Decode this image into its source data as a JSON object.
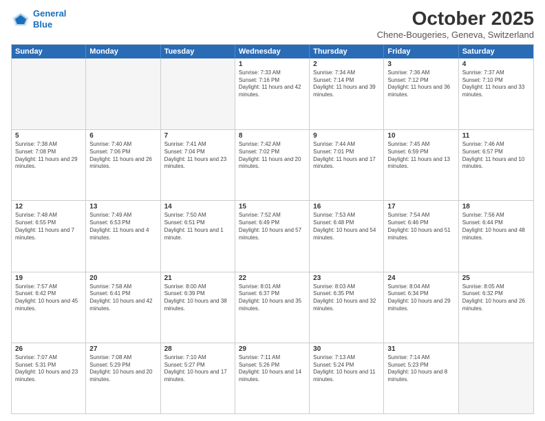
{
  "header": {
    "logo_line1": "General",
    "logo_line2": "Blue",
    "month": "October 2025",
    "location": "Chene-Bougeries, Geneva, Switzerland"
  },
  "days_of_week": [
    "Sunday",
    "Monday",
    "Tuesday",
    "Wednesday",
    "Thursday",
    "Friday",
    "Saturday"
  ],
  "weeks": [
    [
      {
        "day": "",
        "sunrise": "",
        "sunset": "",
        "daylight": "",
        "empty": true
      },
      {
        "day": "",
        "sunrise": "",
        "sunset": "",
        "daylight": "",
        "empty": true
      },
      {
        "day": "",
        "sunrise": "",
        "sunset": "",
        "daylight": "",
        "empty": true
      },
      {
        "day": "1",
        "sunrise": "Sunrise: 7:33 AM",
        "sunset": "Sunset: 7:16 PM",
        "daylight": "Daylight: 11 hours and 42 minutes."
      },
      {
        "day": "2",
        "sunrise": "Sunrise: 7:34 AM",
        "sunset": "Sunset: 7:14 PM",
        "daylight": "Daylight: 11 hours and 39 minutes."
      },
      {
        "day": "3",
        "sunrise": "Sunrise: 7:36 AM",
        "sunset": "Sunset: 7:12 PM",
        "daylight": "Daylight: 11 hours and 36 minutes."
      },
      {
        "day": "4",
        "sunrise": "Sunrise: 7:37 AM",
        "sunset": "Sunset: 7:10 PM",
        "daylight": "Daylight: 11 hours and 33 minutes."
      }
    ],
    [
      {
        "day": "5",
        "sunrise": "Sunrise: 7:38 AM",
        "sunset": "Sunset: 7:08 PM",
        "daylight": "Daylight: 11 hours and 29 minutes."
      },
      {
        "day": "6",
        "sunrise": "Sunrise: 7:40 AM",
        "sunset": "Sunset: 7:06 PM",
        "daylight": "Daylight: 11 hours and 26 minutes."
      },
      {
        "day": "7",
        "sunrise": "Sunrise: 7:41 AM",
        "sunset": "Sunset: 7:04 PM",
        "daylight": "Daylight: 11 hours and 23 minutes."
      },
      {
        "day": "8",
        "sunrise": "Sunrise: 7:42 AM",
        "sunset": "Sunset: 7:02 PM",
        "daylight": "Daylight: 11 hours and 20 minutes."
      },
      {
        "day": "9",
        "sunrise": "Sunrise: 7:44 AM",
        "sunset": "Sunset: 7:01 PM",
        "daylight": "Daylight: 11 hours and 17 minutes."
      },
      {
        "day": "10",
        "sunrise": "Sunrise: 7:45 AM",
        "sunset": "Sunset: 6:59 PM",
        "daylight": "Daylight: 11 hours and 13 minutes."
      },
      {
        "day": "11",
        "sunrise": "Sunrise: 7:46 AM",
        "sunset": "Sunset: 6:57 PM",
        "daylight": "Daylight: 11 hours and 10 minutes."
      }
    ],
    [
      {
        "day": "12",
        "sunrise": "Sunrise: 7:48 AM",
        "sunset": "Sunset: 6:55 PM",
        "daylight": "Daylight: 11 hours and 7 minutes."
      },
      {
        "day": "13",
        "sunrise": "Sunrise: 7:49 AM",
        "sunset": "Sunset: 6:53 PM",
        "daylight": "Daylight: 11 hours and 4 minutes."
      },
      {
        "day": "14",
        "sunrise": "Sunrise: 7:50 AM",
        "sunset": "Sunset: 6:51 PM",
        "daylight": "Daylight: 11 hours and 1 minute."
      },
      {
        "day": "15",
        "sunrise": "Sunrise: 7:52 AM",
        "sunset": "Sunset: 6:49 PM",
        "daylight": "Daylight: 10 hours and 57 minutes."
      },
      {
        "day": "16",
        "sunrise": "Sunrise: 7:53 AM",
        "sunset": "Sunset: 6:48 PM",
        "daylight": "Daylight: 10 hours and 54 minutes."
      },
      {
        "day": "17",
        "sunrise": "Sunrise: 7:54 AM",
        "sunset": "Sunset: 6:46 PM",
        "daylight": "Daylight: 10 hours and 51 minutes."
      },
      {
        "day": "18",
        "sunrise": "Sunrise: 7:56 AM",
        "sunset": "Sunset: 6:44 PM",
        "daylight": "Daylight: 10 hours and 48 minutes."
      }
    ],
    [
      {
        "day": "19",
        "sunrise": "Sunrise: 7:57 AM",
        "sunset": "Sunset: 6:42 PM",
        "daylight": "Daylight: 10 hours and 45 minutes."
      },
      {
        "day": "20",
        "sunrise": "Sunrise: 7:58 AM",
        "sunset": "Sunset: 6:41 PM",
        "daylight": "Daylight: 10 hours and 42 minutes."
      },
      {
        "day": "21",
        "sunrise": "Sunrise: 8:00 AM",
        "sunset": "Sunset: 6:39 PM",
        "daylight": "Daylight: 10 hours and 38 minutes."
      },
      {
        "day": "22",
        "sunrise": "Sunrise: 8:01 AM",
        "sunset": "Sunset: 6:37 PM",
        "daylight": "Daylight: 10 hours and 35 minutes."
      },
      {
        "day": "23",
        "sunrise": "Sunrise: 8:03 AM",
        "sunset": "Sunset: 6:35 PM",
        "daylight": "Daylight: 10 hours and 32 minutes."
      },
      {
        "day": "24",
        "sunrise": "Sunrise: 8:04 AM",
        "sunset": "Sunset: 6:34 PM",
        "daylight": "Daylight: 10 hours and 29 minutes."
      },
      {
        "day": "25",
        "sunrise": "Sunrise: 8:05 AM",
        "sunset": "Sunset: 6:32 PM",
        "daylight": "Daylight: 10 hours and 26 minutes."
      }
    ],
    [
      {
        "day": "26",
        "sunrise": "Sunrise: 7:07 AM",
        "sunset": "Sunset: 5:31 PM",
        "daylight": "Daylight: 10 hours and 23 minutes."
      },
      {
        "day": "27",
        "sunrise": "Sunrise: 7:08 AM",
        "sunset": "Sunset: 5:29 PM",
        "daylight": "Daylight: 10 hours and 20 minutes."
      },
      {
        "day": "28",
        "sunrise": "Sunrise: 7:10 AM",
        "sunset": "Sunset: 5:27 PM",
        "daylight": "Daylight: 10 hours and 17 minutes."
      },
      {
        "day": "29",
        "sunrise": "Sunrise: 7:11 AM",
        "sunset": "Sunset: 5:26 PM",
        "daylight": "Daylight: 10 hours and 14 minutes."
      },
      {
        "day": "30",
        "sunrise": "Sunrise: 7:13 AM",
        "sunset": "Sunset: 5:24 PM",
        "daylight": "Daylight: 10 hours and 11 minutes."
      },
      {
        "day": "31",
        "sunrise": "Sunrise: 7:14 AM",
        "sunset": "Sunset: 5:23 PM",
        "daylight": "Daylight: 10 hours and 8 minutes."
      },
      {
        "day": "",
        "sunrise": "",
        "sunset": "",
        "daylight": "",
        "empty": true
      }
    ]
  ]
}
